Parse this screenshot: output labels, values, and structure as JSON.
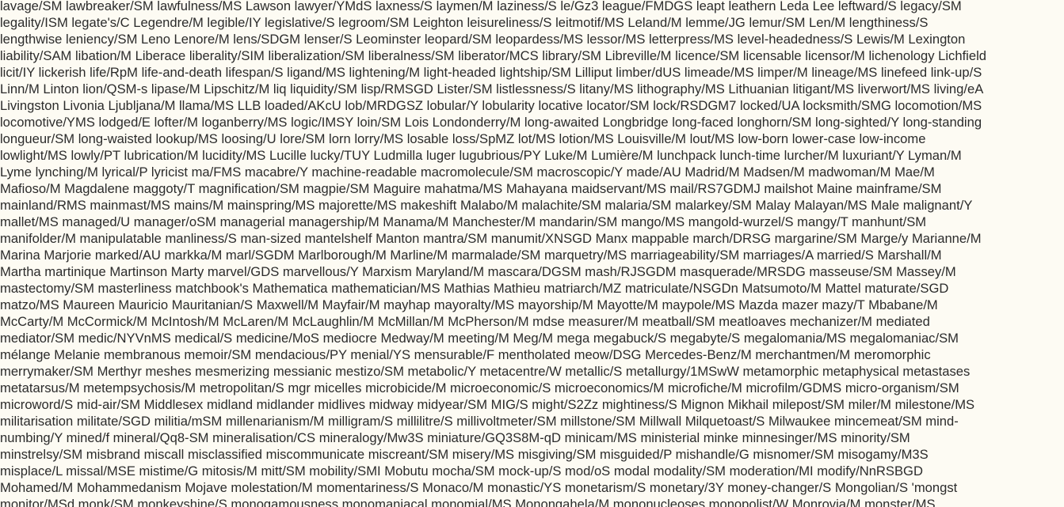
{
  "document": {
    "lines": [
      "lavage/SM lawbreaker/SM lawfulness/MS Lawson lawyer/YMdS laxness/S laymen/M laziness/S le/Gz3 league/FMDGS leapt leathern Leda Lee leftward/S legacy/SM",
      "legality/ISM legate's/C Legendre/M legible/IY legislative/S legroom/SM Leighton leisureliness/S leitmotif/MS Leland/M lemme/JG lemur/SM Len/M lengthiness/S",
      "lengthwise leniency/SM Leno Lenore/M lens/SDGM lenser/S Leominster leopard/SM leopardess/MS lessor/MS letterpress/MS level-headedness/S Lewis/M Lexington",
      "liability/SAM libation/M Liberace liberality/SIM liberalization/SM liberalness/SM liberator/MCS library/SM Libreville/M licence/SM licensable licensor/M lichenology Lichfield",
      "licit/IY lickerish life/RpM life-and-death lifespan/S ligand/MS lightening/M light-headed lightship/SM Lilliput limber/dUS limeade/MS limper/M lineage/MS linefeed link-up/S",
      "Linn/M Linton lion/QSM-s lipase/M Lipschitz/M liq liquidity/SM lisp/RMSGD Lister/SM listlessness/S litany/MS lithography/MS Lithuanian litigant/MS liverwort/MS living/eA",
      "Livingston Livonia Ljubljana/M llama/MS LLB loaded/AKcU lob/MRDGSZ lobular/Y lobularity locative locator/SM lock/RSDGM7 locked/UA locksmith/SMG locomotion/MS",
      "locomotive/YMS lodged/E lofter/M loganberry/MS logic/IMSY loin/SM Lois Londonderry/M long-awaited Longbridge long-faced longhorn/SM long-sighted/Y long-standing",
      "longueur/SM long-waisted lookup/MS loosing/U lore/SM lorn lorry/MS losable loss/SpMZ lot/MS lotion/MS Louisville/M lout/MS low-born lower-case low-income",
      "lowlight/MS lowly/PT lubrication/M lucidity/MS Lucille lucky/TUY Ludmilla luger lugubrious/PY Luke/M Lumière/M lunchpack lunch-time lurcher/M luxuriant/Y Lyman/M",
      "Lyme lynching/M lyrical/P lyricist ma/FMS macabre/Y machine-readable macromolecule/SM macroscopic/Y made/AU Madrid/M Madsen/M madwoman/M Mae/M",
      "Mafioso/M Magdalene maggoty/T magnification/SM magpie/SM Maguire mahatma/MS Mahayana maidservant/MS mail/RS7GDMJ mailshot Maine mainframe/SM",
      "mainland/RMS mainmast/MS mains/M mainspring/MS majorette/MS makeshift Malabo/M malachite/SM malaria/SM malarkey/SM Malay Malayan/MS Male malignant/Y",
      "mallet/MS managed/U manager/oSM managerial managership/M Manama/M Manchester/M mandarin/SM mango/MS mangold-wurzel/S mangy/T manhunt/SM",
      "manifolder/M manipulatable manliness/S man-sized mantelshelf Manton mantra/SM manumit/XNSGD Manx mappable march/DRSG margarine/SM Marge/y Marianne/M",
      "Marina Marjorie marked/AU markka/M marl/SGDM Marlborough/M Marline/M marmalade/SM marquetry/MS marriageability/SM marriages/A married/S Marshall/M",
      "Martha martinique Martinson Marty marvel/GDS marvellous/Y Marxism Maryland/M mascara/DGSM mash/RJSGDM masquerade/MRSDG masseuse/SM Massey/M",
      "mastectomy/SM masterliness matchbook's Mathematica mathematician/MS Mathias Mathieu matriarch/MZ matriculate/NSGDn Matsumoto/M Mattel maturate/SGD",
      "matzo/MS Maureen Mauricio Mauritanian/S Maxwell/M Mayfair/M mayhap mayoralty/MS mayorship/M Mayotte/M maypole/MS Mazda mazer mazy/T Mbabane/M",
      "McCarty/M McCormick/M McIntosh/M McLaren/M McLaughlin/M McMillan/M McPherson/M mdse measurer/M meatball/SM meatloaves mechanizer/M mediated",
      "mediator/SM medic/NYVnMS medical/S medicine/MoS mediocre Medway/M meeting/M Meg/M mega megabuck/S megabyte/S megalomania/MS megalomaniac/SM",
      "mélange Melanie membranous memoir/SM mendacious/PY menial/YS mensurable/F mentholated meow/DSG Mercedes-Benz/M merchantmen/M meromorphic",
      "merrymaker/SM Merthyr meshes mesmerizing messianic mestizo/SM metabolic/Y metacentre/W metallic/S metallurgy/1MSwW metamorphic metaphysical metastases",
      "metatarsus/M metempsychosis/M metropolitan/S mgr micelles microbicide/M microeconomic/S microeconomics/M microfiche/M microfilm/GDMS micro-organism/SM",
      "microword/S mid-air/SM Middlesex midland midlander midlives midway midyear/SM MIG/S might/S2Zz mightiness/S Mignon Mikhail milepost/SM miler/M milestone/MS",
      "militarisation militate/SGD militia/mSM millenarianism/M milligram/S millilitre/S millivoltmeter/SM millstone/SM Millwall Milquetoast/S Milwaukee mincemeat/SM mind-",
      "numbing/Y mined/f mineral/Qq8-SM mineralisation/CS mineralogy/Mw3S miniature/GQ3S8M-qD minicam/MS ministerial minke minnesinger/MS minority/SM",
      "minstrelsy/SM misbrand miscall misclassified miscommunicate miscreant/SM misery/MS misgiving/SM misguided/P mishandle/G misnomer/SM misogamy/M3S",
      "misplace/L missal/MSE mistime/G mitosis/M mitt/SM mobility/SMI Mobutu mocha/SM mock-up/S mod/oS modal modality/SM moderation/MI modify/NnRSBGD",
      "Mohamed/M Mohammedanism Mojave molestation/M momentariness/S Monaco/M monastic/YS monetarism/S monetary/3Y money-changer/S Mongolian/S 'mongst",
      "monitor/MSd monk/SM monkeyshine/S monogamousness monomaniacal monomial/MS Monongahela/M mononucleoses monopolist/W Monrovia/M monster/MS"
    ]
  }
}
